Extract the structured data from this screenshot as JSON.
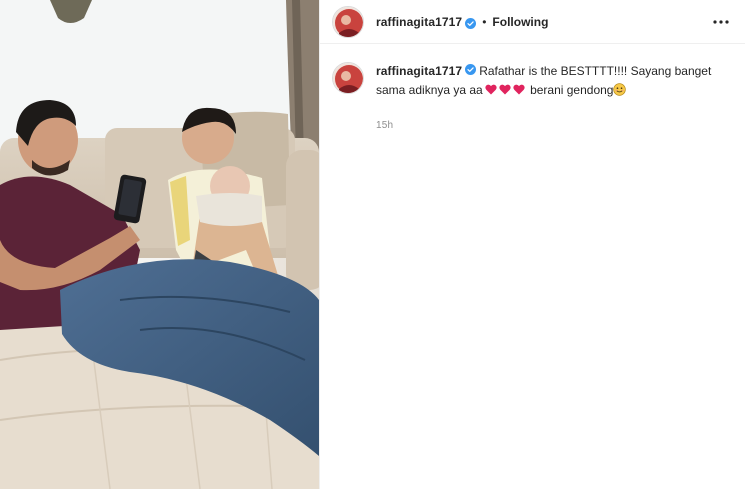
{
  "post": {
    "username": "raffinagita1717",
    "separator": "•",
    "follow_status": "Following",
    "more_icon": "more-horizontal-icon",
    "verified_icon": "verified-badge-icon",
    "caption": {
      "username": "raffinagita1717",
      "text_part1": "Rafathar is the BESTTTT!!!! Sayang banget sama adiknya ya aa",
      "text_part2": " berani gendong",
      "heart_emoji": "red-heart-emoji",
      "heart_count": 3,
      "face_emoji": "smiling-face-emoji"
    },
    "timestamp": "15h",
    "colors": {
      "verified": "#3897f0",
      "heart": "#e0245e",
      "text": "#262626",
      "muted": "#8e8e8e"
    }
  }
}
